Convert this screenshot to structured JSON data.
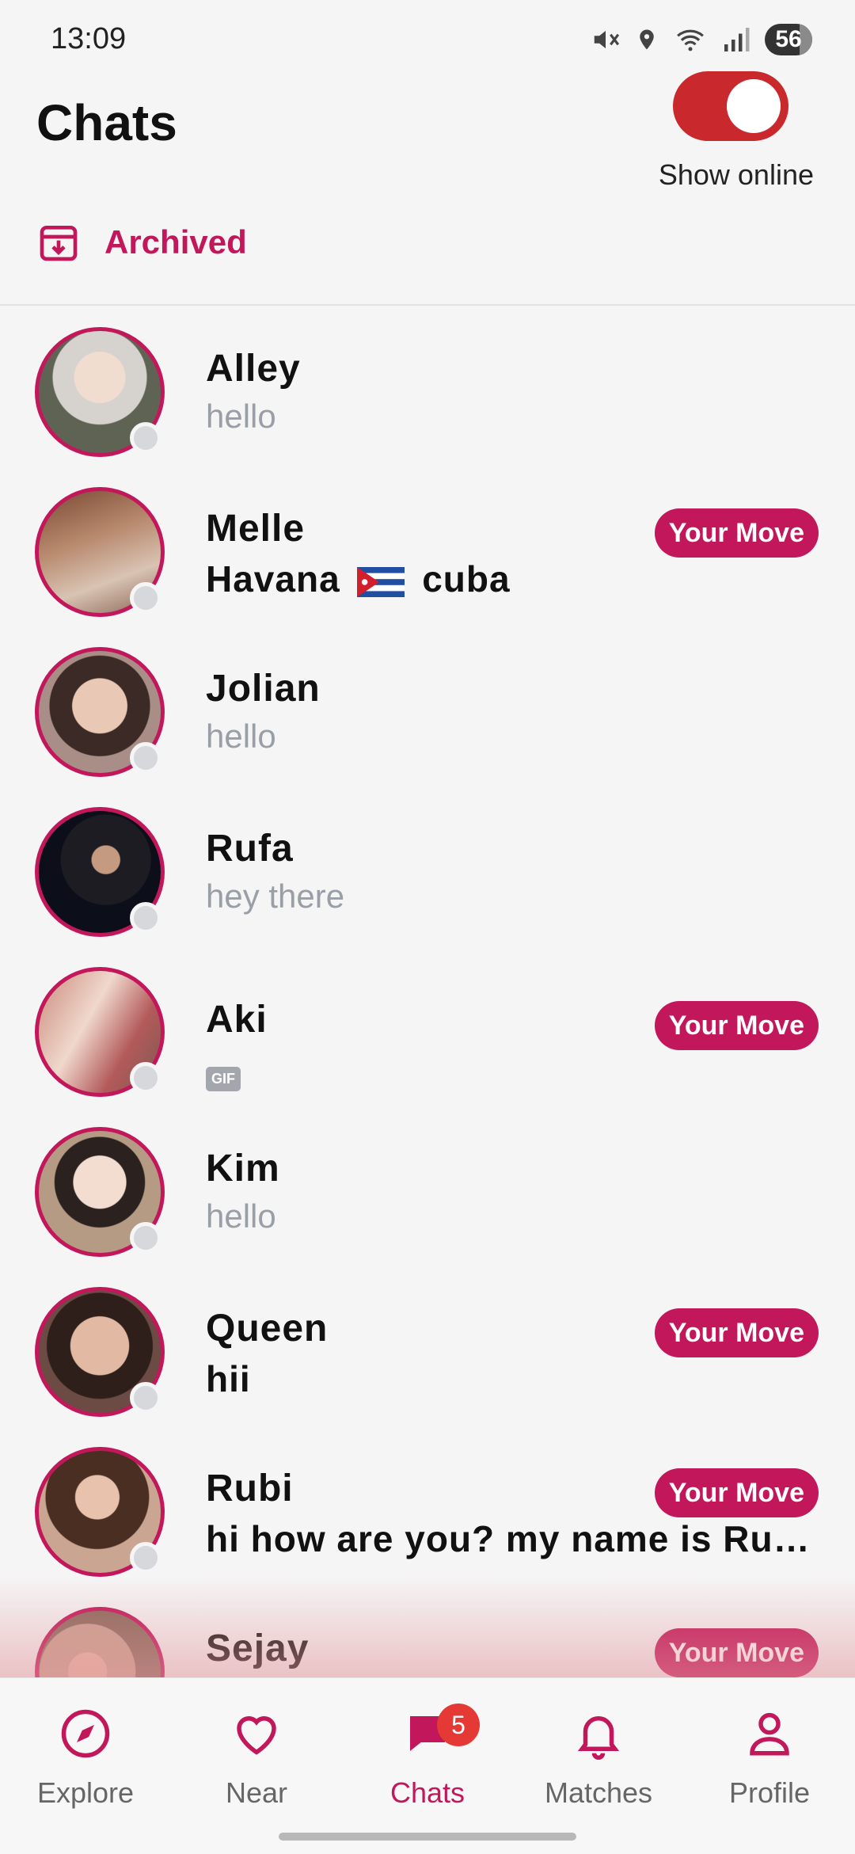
{
  "status_bar": {
    "time": "13:09",
    "battery": "56"
  },
  "header": {
    "title": "Chats",
    "toggle_label": "Show online",
    "toggle_on": true
  },
  "archived": {
    "label": "Archived"
  },
  "chats": [
    {
      "name": "Alley",
      "message": "hello",
      "unread": false,
      "badge": ""
    },
    {
      "name": "Melle",
      "message_before_flag": "Havana",
      "flag": "cuba-flag",
      "message_after_flag": "cuba",
      "unread": true,
      "badge": "Your Move"
    },
    {
      "name": "Jolian",
      "message": "hello",
      "unread": false,
      "badge": ""
    },
    {
      "name": "Rufa",
      "message": "hey there",
      "unread": false,
      "badge": ""
    },
    {
      "name": "Aki",
      "message": "GIF",
      "unread": false,
      "badge": "Your Move"
    },
    {
      "name": "Kim",
      "message": "hello",
      "unread": false,
      "badge": ""
    },
    {
      "name": "Queen",
      "message": "hii",
      "unread": true,
      "badge": "Your Move"
    },
    {
      "name": "Rubi",
      "message": "hi how are you? my name is Ru…",
      "unread": true,
      "badge": "Your Move"
    },
    {
      "name": "Sejay",
      "message": "",
      "unread": true,
      "badge": "Your Move"
    }
  ],
  "nav": {
    "explore": "Explore",
    "near": "Near",
    "chats": "Chats",
    "chats_badge": "5",
    "matches": "Matches",
    "profile": "Profile"
  },
  "colors": {
    "accent": "#c2185b",
    "toggle": "#c9282d",
    "badge_red": "#e53935"
  }
}
